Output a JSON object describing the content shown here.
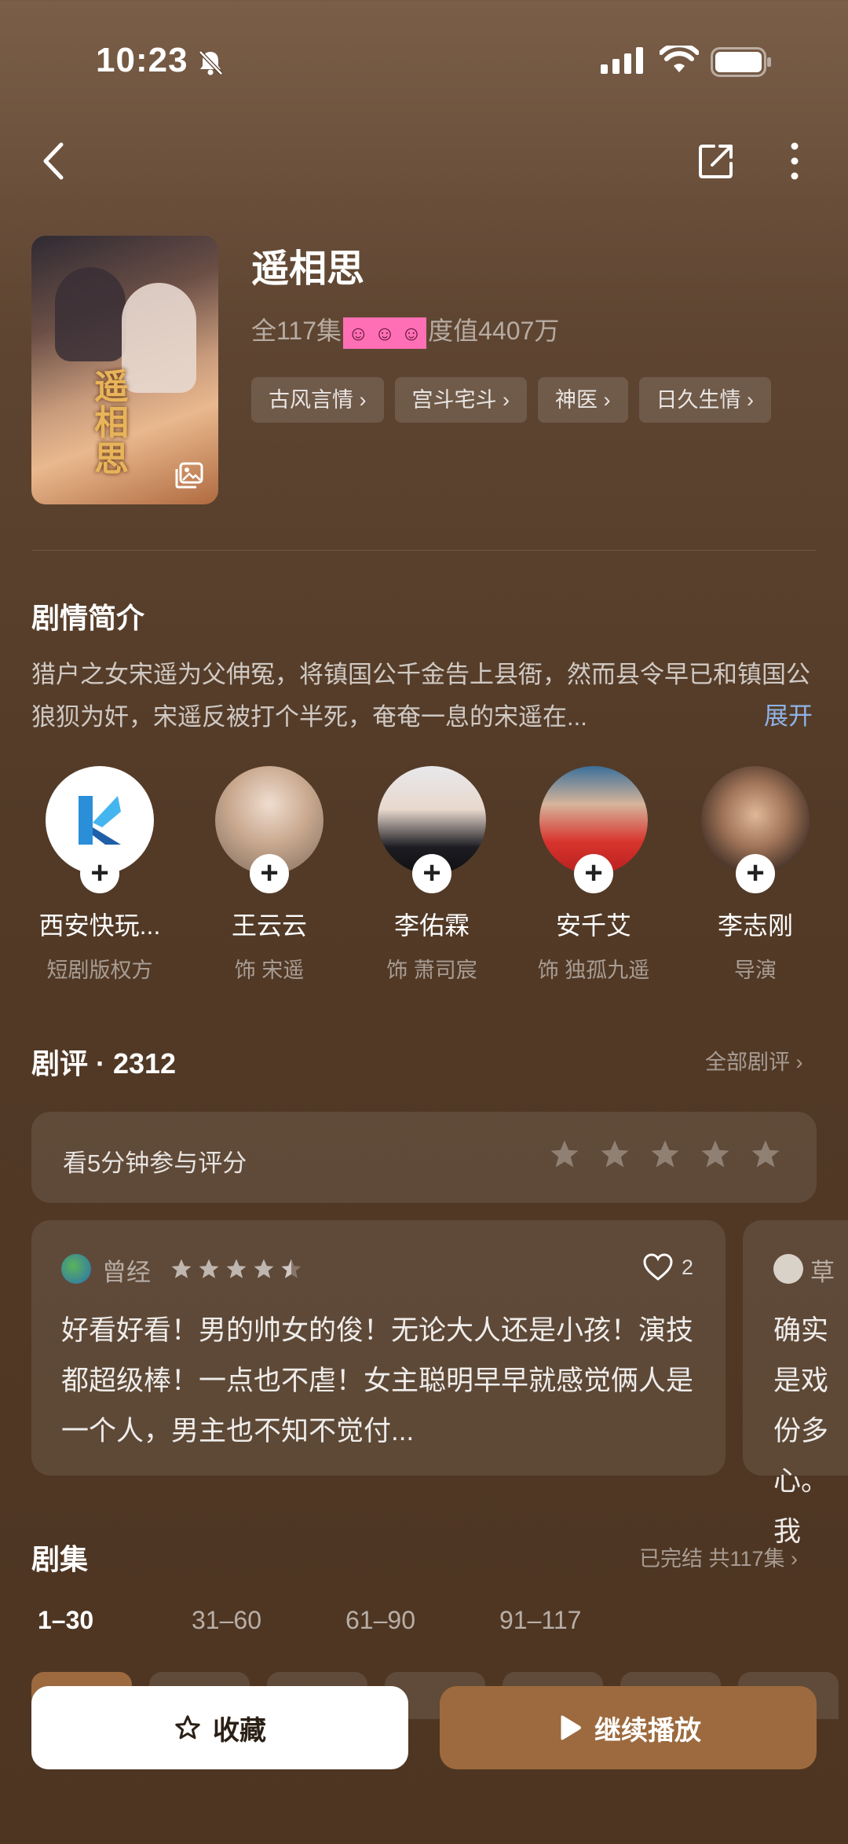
{
  "status_bar": {
    "time": "10:23"
  },
  "drama": {
    "title": "遥相思",
    "episodes_label": "全117集",
    "heat_label": "度值4407万",
    "poster_title": "遥相思",
    "tags": [
      "古风言情",
      "宫斗宅斗",
      "神医",
      "日久生情"
    ]
  },
  "synopsis": {
    "title": "剧情简介",
    "text": "猎户之女宋遥为父伸冤，将镇国公千金告上县衙，然而县令早已和镇国公狼狈为奸，宋遥反被打个半死，奄奄一息的宋遥在...",
    "expand_label": "展开"
  },
  "cast": [
    {
      "name": "西安快玩...",
      "role": "短剧版权方"
    },
    {
      "name": "王云云",
      "role": "饰 宋遥"
    },
    {
      "name": "李佑霖",
      "role": "饰 萧司宸"
    },
    {
      "name": "安千艾",
      "role": "饰 独孤九遥"
    },
    {
      "name": "李志刚",
      "role": "导演"
    }
  ],
  "reviews": {
    "title": "剧评 · 2312",
    "all_label": "全部剧评 ›",
    "rate_prompt": "看5分钟参与评分",
    "items": [
      {
        "user": "曾经",
        "rating": 4.5,
        "likes": "2",
        "text": "好看好看！男的帅女的俊！无论大人还是小孩！演技都超级棒！一点也不虐！女主聪明早早就感觉俩人是一个人，男主也不知不觉付..."
      },
      {
        "user": "草",
        "text": "确实是戏份多心。我"
      }
    ]
  },
  "episodes": {
    "title": "剧集",
    "status": "已完结 共117集 ›",
    "ranges": [
      "1–30",
      "31–60",
      "61–90",
      "91–117"
    ],
    "active_range": "1–30"
  },
  "actions": {
    "favorite_label": "收藏",
    "play_label": "继续播放"
  },
  "colors": {
    "accent": "#9c6a3e",
    "link": "#8fb3e8",
    "sticker": "#ff6fb5"
  }
}
